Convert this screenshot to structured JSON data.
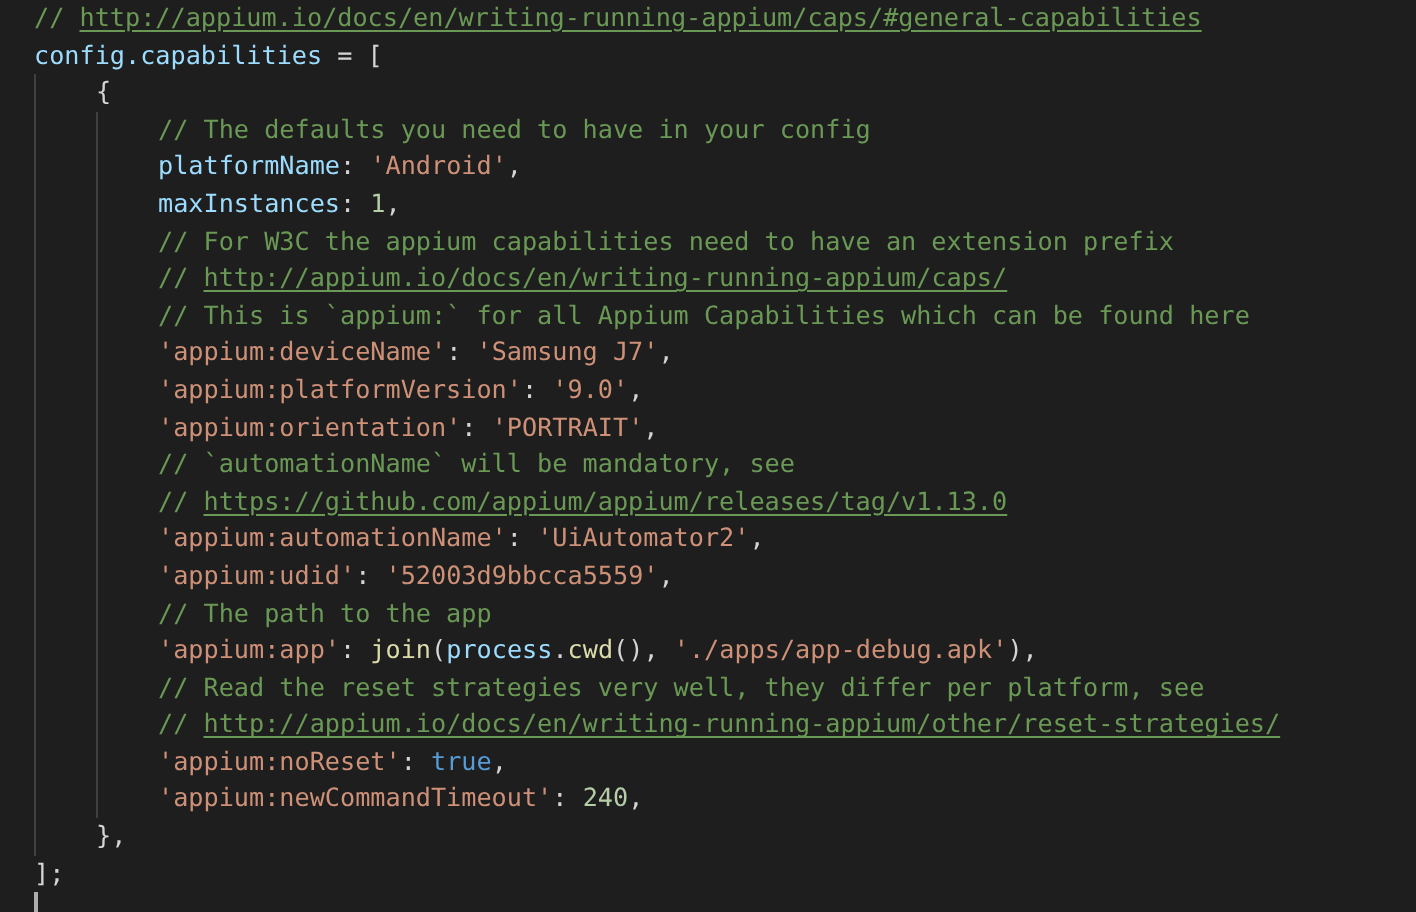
{
  "editor": {
    "lines": [
      {
        "tokens": [
          {
            "kind": "comment",
            "text": "// "
          },
          {
            "kind": "link",
            "text": "http://appium.io/docs/en/writing-running-appium/caps/#general-capabilities"
          }
        ]
      },
      {
        "tokens": [
          {
            "kind": "variable",
            "text": "config.capabilities"
          },
          {
            "kind": "punct",
            "text": " = ["
          }
        ],
        "children": [
          {
            "tokens": [
              {
                "kind": "punct",
                "text": "{"
              }
            ],
            "children": [
              {
                "tokens": [
                  {
                    "kind": "comment",
                    "text": "// The defaults you need to have in your config"
                  }
                ]
              },
              {
                "tokens": [
                  {
                    "kind": "variable",
                    "text": "platformName"
                  },
                  {
                    "kind": "punct",
                    "text": ": "
                  },
                  {
                    "kind": "string",
                    "text": "'Android'"
                  },
                  {
                    "kind": "punct",
                    "text": ","
                  }
                ]
              },
              {
                "tokens": [
                  {
                    "kind": "variable",
                    "text": "maxInstances"
                  },
                  {
                    "kind": "punct",
                    "text": ": "
                  },
                  {
                    "kind": "number",
                    "text": "1"
                  },
                  {
                    "kind": "punct",
                    "text": ","
                  }
                ]
              },
              {
                "tokens": [
                  {
                    "kind": "comment",
                    "text": "// For W3C the appium capabilities need to have an extension prefix"
                  }
                ]
              },
              {
                "tokens": [
                  {
                    "kind": "comment",
                    "text": "// "
                  },
                  {
                    "kind": "link",
                    "text": "http://appium.io/docs/en/writing-running-appium/caps/"
                  }
                ]
              },
              {
                "tokens": [
                  {
                    "kind": "comment",
                    "text": "// This is `appium:` for all Appium Capabilities which can be found here"
                  }
                ]
              },
              {
                "tokens": [
                  {
                    "kind": "string",
                    "text": "'appium:deviceName'"
                  },
                  {
                    "kind": "punct",
                    "text": ": "
                  },
                  {
                    "kind": "string",
                    "text": "'Samsung J7'"
                  },
                  {
                    "kind": "punct",
                    "text": ","
                  }
                ]
              },
              {
                "tokens": [
                  {
                    "kind": "string",
                    "text": "'appium:platformVersion'"
                  },
                  {
                    "kind": "punct",
                    "text": ": "
                  },
                  {
                    "kind": "string",
                    "text": "'9.0'"
                  },
                  {
                    "kind": "punct",
                    "text": ","
                  }
                ]
              },
              {
                "tokens": [
                  {
                    "kind": "string",
                    "text": "'appium:orientation'"
                  },
                  {
                    "kind": "punct",
                    "text": ": "
                  },
                  {
                    "kind": "string",
                    "text": "'PORTRAIT'"
                  },
                  {
                    "kind": "punct",
                    "text": ","
                  }
                ]
              },
              {
                "tokens": [
                  {
                    "kind": "comment",
                    "text": "// `automationName` will be mandatory, see"
                  }
                ]
              },
              {
                "tokens": [
                  {
                    "kind": "comment",
                    "text": "// "
                  },
                  {
                    "kind": "link",
                    "text": "https://github.com/appium/appium/releases/tag/v1.13.0"
                  }
                ]
              },
              {
                "tokens": [
                  {
                    "kind": "string",
                    "text": "'appium:automationName'"
                  },
                  {
                    "kind": "punct",
                    "text": ": "
                  },
                  {
                    "kind": "string",
                    "text": "'UiAutomator2'"
                  },
                  {
                    "kind": "punct",
                    "text": ","
                  }
                ]
              },
              {
                "tokens": [
                  {
                    "kind": "string",
                    "text": "'appium:udid'"
                  },
                  {
                    "kind": "punct",
                    "text": ": "
                  },
                  {
                    "kind": "string",
                    "text": "'52003d9bbcca5559'"
                  },
                  {
                    "kind": "punct",
                    "text": ","
                  }
                ]
              },
              {
                "tokens": [
                  {
                    "kind": "comment",
                    "text": "// The path to the app"
                  }
                ]
              },
              {
                "tokens": [
                  {
                    "kind": "string",
                    "text": "'appium:app'"
                  },
                  {
                    "kind": "punct",
                    "text": ": "
                  },
                  {
                    "kind": "function",
                    "text": "join"
                  },
                  {
                    "kind": "punct",
                    "text": "("
                  },
                  {
                    "kind": "variable",
                    "text": "process"
                  },
                  {
                    "kind": "punct",
                    "text": "."
                  },
                  {
                    "kind": "function",
                    "text": "cwd"
                  },
                  {
                    "kind": "punct",
                    "text": "(), "
                  },
                  {
                    "kind": "string",
                    "text": "'./apps/app-debug.apk'"
                  },
                  {
                    "kind": "punct",
                    "text": "),"
                  }
                ]
              },
              {
                "tokens": [
                  {
                    "kind": "comment",
                    "text": "// Read the reset strategies very well, they differ per platform, see"
                  }
                ]
              },
              {
                "tokens": [
                  {
                    "kind": "comment",
                    "text": "// "
                  },
                  {
                    "kind": "link",
                    "text": "http://appium.io/docs/en/writing-running-appium/other/reset-strategies/"
                  }
                ]
              },
              {
                "tokens": [
                  {
                    "kind": "string",
                    "text": "'appium:noReset'"
                  },
                  {
                    "kind": "punct",
                    "text": ": "
                  },
                  {
                    "kind": "keyword",
                    "text": "true"
                  },
                  {
                    "kind": "punct",
                    "text": ","
                  }
                ]
              },
              {
                "tokens": [
                  {
                    "kind": "string",
                    "text": "'appium:newCommandTimeout'"
                  },
                  {
                    "kind": "punct",
                    "text": ": "
                  },
                  {
                    "kind": "number",
                    "text": "240"
                  },
                  {
                    "kind": "punct",
                    "text": ","
                  }
                ]
              }
            ]
          },
          {
            "tokens": [
              {
                "kind": "punct",
                "text": "},"
              }
            ]
          }
        ]
      },
      {
        "tokens": [
          {
            "kind": "punct",
            "text": "];"
          }
        ]
      }
    ]
  }
}
